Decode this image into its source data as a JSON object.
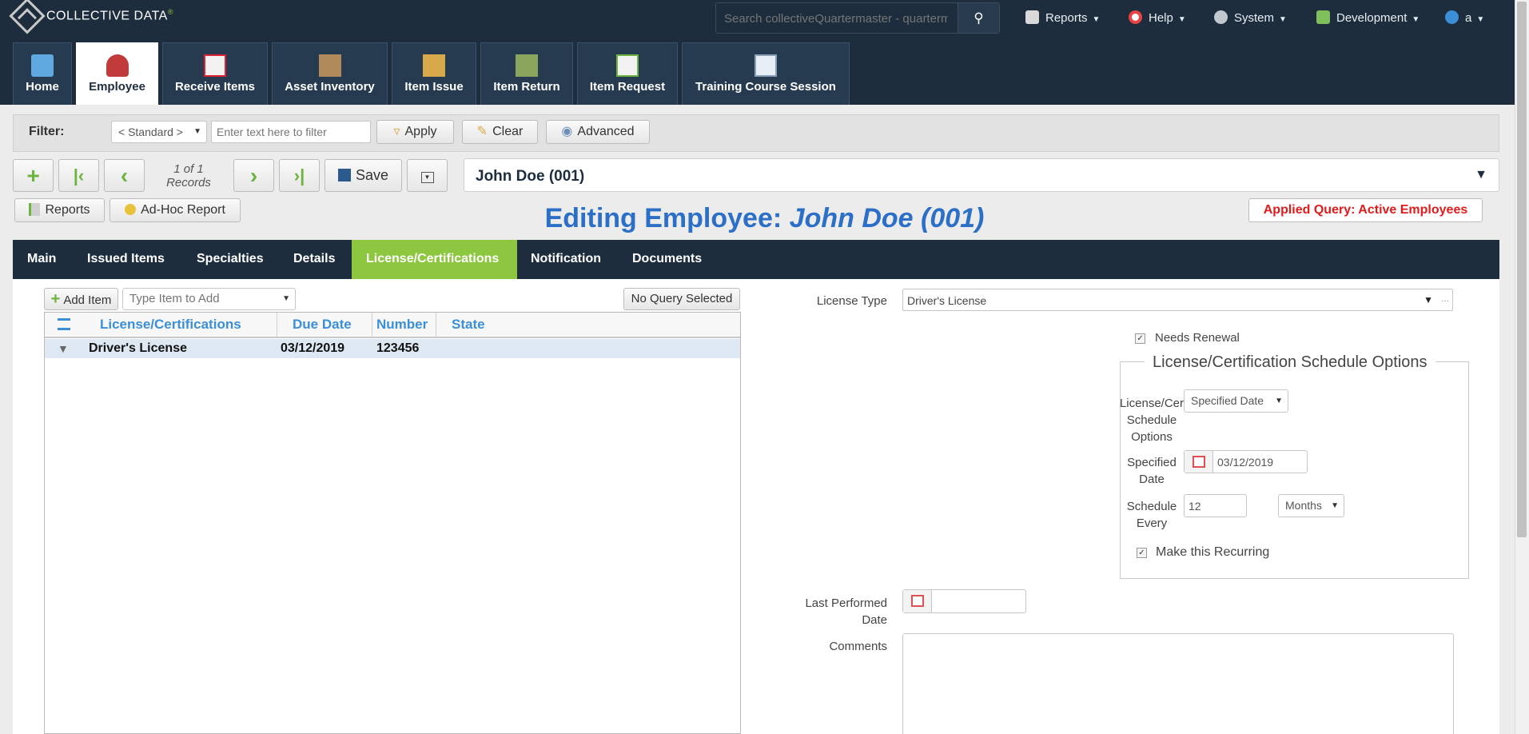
{
  "app": {
    "brand": "COLLECTIVE DATA",
    "brand_mark": "®"
  },
  "search": {
    "placeholder": "Search collectiveQuartermaster - quartermaster"
  },
  "top_menu": [
    {
      "label": "Reports",
      "icon": "reports-icon"
    },
    {
      "label": "Help",
      "icon": "lifebuoy-icon"
    },
    {
      "label": "System",
      "icon": "gear-icon"
    },
    {
      "label": "Development",
      "icon": "development-icon"
    },
    {
      "label": "a",
      "icon": "globe-user-icon"
    }
  ],
  "nav_tabs": [
    {
      "label": "Home",
      "icon": "home-icon"
    },
    {
      "label": "Employee",
      "icon": "employee-icon"
    },
    {
      "label": "Receive Items",
      "icon": "receive-items-icon"
    },
    {
      "label": "Asset Inventory",
      "icon": "asset-inventory-icon"
    },
    {
      "label": "Item Issue",
      "icon": "item-issue-icon"
    },
    {
      "label": "Item Return",
      "icon": "item-return-icon"
    },
    {
      "label": "Item Request",
      "icon": "item-request-icon"
    },
    {
      "label": "Training Course Session",
      "icon": "training-course-icon"
    }
  ],
  "filter": {
    "label": "Filter:",
    "preset": "< Standard >",
    "placeholder": "Enter text here to filter",
    "apply": "Apply",
    "clear": "Clear",
    "advanced": "Advanced"
  },
  "record_nav": {
    "counter_line1": "1 of 1",
    "counter_line2": "Records",
    "save": "Save",
    "record_select": "John Doe (001)"
  },
  "toolbar2": {
    "reports": "Reports",
    "adhoc": "Ad-Hoc Report"
  },
  "page_title": {
    "prefix": "Editing Employee:",
    "name": "John Doe (001)"
  },
  "applied_query": "Applied Query: Active Employees",
  "section_tabs": [
    "Main",
    "Issued Items",
    "Specialties",
    "Details",
    "License/Certifications",
    "Notification",
    "Documents"
  ],
  "item_toolbar": {
    "add_item": "Add Item",
    "type_placeholder": "Type Item to Add",
    "query_button": "No Query Selected"
  },
  "grid": {
    "columns": [
      "License/Certifications",
      "Due Date",
      "Number",
      "State"
    ],
    "rows": [
      {
        "license": "Driver's License",
        "due_date": "03/12/2019",
        "number": "123456",
        "state": ""
      }
    ]
  },
  "form": {
    "license_type_label": "License Type",
    "license_type_value": "Driver's License",
    "needs_renewal_label": "Needs Renewal",
    "needs_renewal": true,
    "schedule_legend": "License/Certification Schedule Options",
    "schedule_options_label_1": "License/Cer",
    "schedule_options_label_2": "Schedule",
    "schedule_options_label_3": "Options",
    "schedule_options_value": "Specified Date",
    "specified_date_label_1": "Specified",
    "specified_date_label_2": "Date",
    "specified_date_value": "03/12/2019",
    "schedule_every_label_1": "Schedule",
    "schedule_every_label_2": "Every",
    "schedule_every_value": "12",
    "schedule_every_unit": "Months",
    "recurring_label": "Make this Recurring",
    "recurring": true,
    "last_performed_label_1": "Last Performed",
    "last_performed_label_2": "Date",
    "last_performed_value": "",
    "comments_label": "Comments",
    "comments_value": ""
  }
}
